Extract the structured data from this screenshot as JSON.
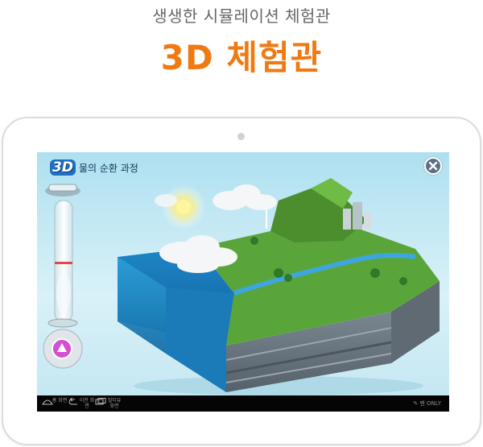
{
  "header": {
    "subtitle": "생생한 시뮬레이션 체험관",
    "title": "3D 체험관"
  },
  "app": {
    "badge": "3D",
    "title": "물의 순환 과정"
  },
  "nav": {
    "home_label": "홈 화면",
    "back_label": "이전 화면",
    "recent_label": "멀티뷰 화면",
    "pen_only_label": "펜 ONLY"
  },
  "colors": {
    "accent": "#f07a12",
    "subtitle": "#666666",
    "bezel": "#dcdcdc"
  },
  "icons": [
    "close-icon",
    "play-icon",
    "home-icon",
    "back-icon",
    "multiview-icon",
    "pen-icon"
  ]
}
